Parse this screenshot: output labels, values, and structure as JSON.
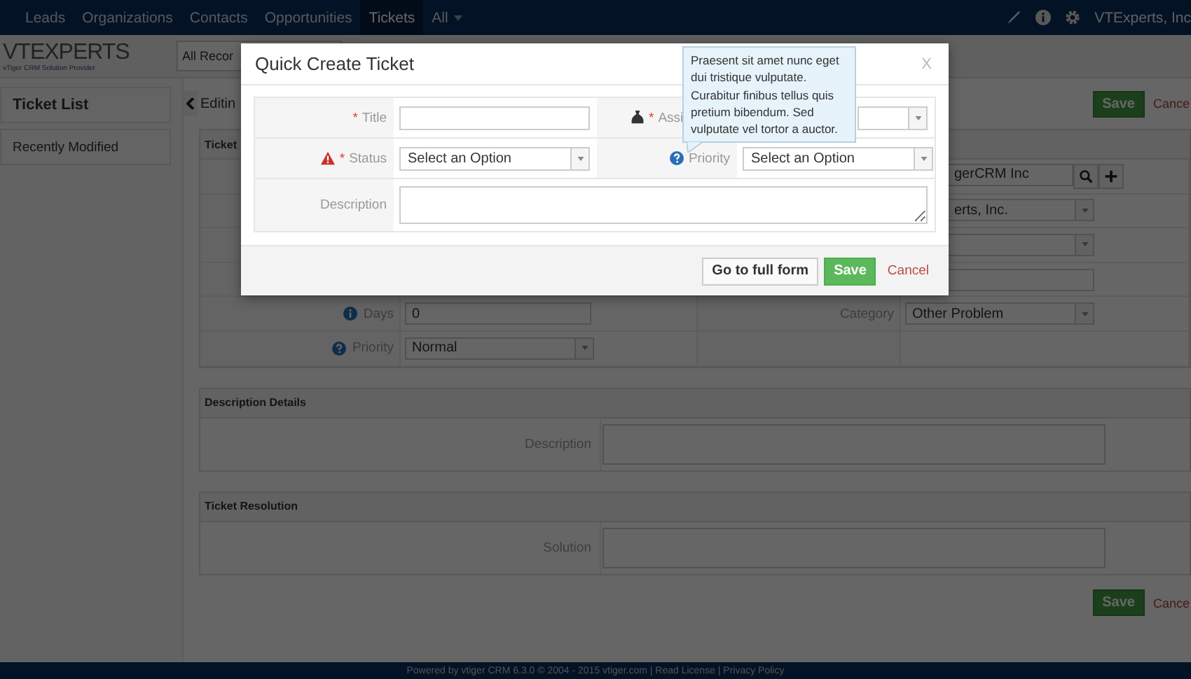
{
  "top_nav": {
    "items": [
      {
        "label": "Leads",
        "selected": false
      },
      {
        "label": "Organizations",
        "selected": false
      },
      {
        "label": "Contacts",
        "selected": false
      },
      {
        "label": "Opportunities",
        "selected": false
      },
      {
        "label": "Tickets",
        "selected": true
      },
      {
        "label": "All",
        "selected": false,
        "dropdown": true
      }
    ],
    "account": "VTExperts, Inc"
  },
  "logo": {
    "name": "VTEXPERTS",
    "tagline": "vTiger CRM Solution Provider"
  },
  "filter_dropdown": "All Recor",
  "sidebar": {
    "title": "Ticket List",
    "items": [
      "Recently Modified"
    ]
  },
  "page": {
    "heading": "Editin",
    "save": "Save",
    "cancel": "Cance",
    "block_title": "Ticket",
    "rows": [
      {
        "right": {
          "kind": "lookup",
          "value": "gerCRM Inc"
        }
      },
      {
        "right": {
          "kind": "select",
          "value": "erts, Inc."
        }
      },
      {
        "right": {
          "kind": "select"
        }
      },
      {
        "right": {
          "kind": "input"
        }
      },
      {
        "left": {
          "label": "Days",
          "kind": "input",
          "value": "0"
        },
        "right": {
          "label": "Category",
          "kind": "select",
          "value": "Other Problem"
        }
      },
      {
        "left": {
          "label": "Priority",
          "kind": "select",
          "value": "Normal"
        }
      }
    ],
    "sections": [
      {
        "title": "Description Details",
        "label": "Description"
      },
      {
        "title": "Ticket Resolution",
        "label": "Solution"
      }
    ],
    "bottom_save": "Save",
    "bottom_cancel": "Cance"
  },
  "footer": "Powered by vtiger CRM 6.3.0  © 2004 - 2015  vtiger.com | Read License | Privacy Policy",
  "modal": {
    "title": "Quick Create Ticket",
    "close": "X",
    "rows": [
      {
        "cells": [
          {
            "label": "Title",
            "marker": "*",
            "kind": "input"
          },
          {
            "label": "Assi",
            "marker": "*",
            "kind": "select"
          }
        ]
      },
      {
        "cells": [
          {
            "label": "Status",
            "marker": "*",
            "kind": "select",
            "value": "Select an Option"
          },
          {
            "label": "Priority",
            "kind": "select",
            "value": "Select an Option"
          }
        ]
      },
      {
        "cells": [
          {
            "label": "Description",
            "kind": "textarea"
          }
        ]
      }
    ],
    "buttons": {
      "full_form": "Go to full form",
      "save": "Save",
      "cancel": "Cancel"
    }
  },
  "tooltip": {
    "text": "Praesent sit amet nunc eget dui tristique vulputate. Curabitur finibus tellus quis pretium bibendum. Sed vulputate vel tortor a auctor."
  }
}
